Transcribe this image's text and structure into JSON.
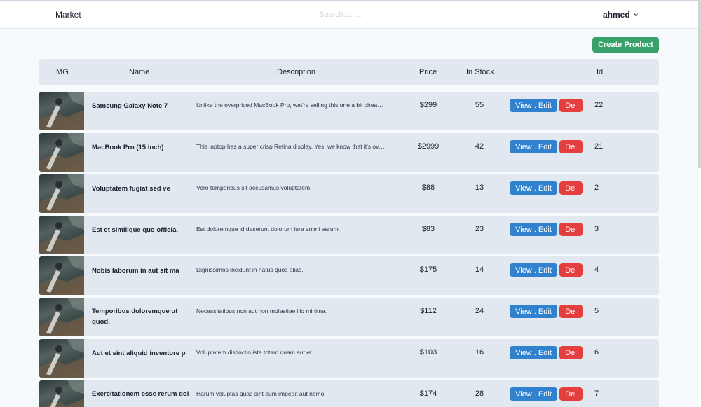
{
  "nav": {
    "brand": "Market",
    "search_placeholder": "Search.........",
    "user": "ahmed"
  },
  "actions": {
    "create_label": "Create Product"
  },
  "table": {
    "headers": [
      "IMG",
      "Name",
      "Description",
      "Price",
      "In Stock",
      "Id"
    ],
    "view_label": "View . Edit",
    "del_label": "Del",
    "rows": [
      {
        "name": "Samsung Galaxy Note 7",
        "description": "Unlike the overpriced MacBook Pro, we\\'re selling this one a bit cheap, and you can use it to keep warm.",
        "price": "$299",
        "stock": "55",
        "id": "22"
      },
      {
        "name": "MacBook Pro (15 inch)",
        "description": "This laptop has a super crisp Retina display. Yes, we know that it's overpriced...",
        "price": "$2999",
        "stock": "42",
        "id": "21"
      },
      {
        "name": "Voluptatem fugiat sed ve",
        "description": "Vero temporibus sit accusamus voluptatem.",
        "price": "$88",
        "stock": "13",
        "id": "2"
      },
      {
        "name": "Est et similique quo officia.",
        "description": "Est doloremque id deserunt dolorum iure animi earum.",
        "price": "$83",
        "stock": "23",
        "id": "3"
      },
      {
        "name": "Nobis laborum in aut sit ma",
        "description": "Dignissimos incidunt in natus quos alias.",
        "price": "$175",
        "stock": "14",
        "id": "4"
      },
      {
        "name": "Temporibus doloremque ut quod.",
        "description": "Necessitatibus non aut non molestiae illo minima.",
        "price": "$112",
        "stock": "24",
        "id": "5"
      },
      {
        "name": "Aut et sint aliquid inventore p",
        "description": "Voluptatem distinctio iste totam quam aut et.",
        "price": "$103",
        "stock": "16",
        "id": "6"
      },
      {
        "name": "Exercitationem esse rerum dol",
        "description": "Harum voluptas quas sint eum impedit aut nemo.",
        "price": "$174",
        "stock": "28",
        "id": "7"
      }
    ]
  },
  "colors": {
    "create": "#38a169",
    "view": "#3182ce",
    "delete": "#e53e3e",
    "row_bg": "#e2e8f0"
  }
}
